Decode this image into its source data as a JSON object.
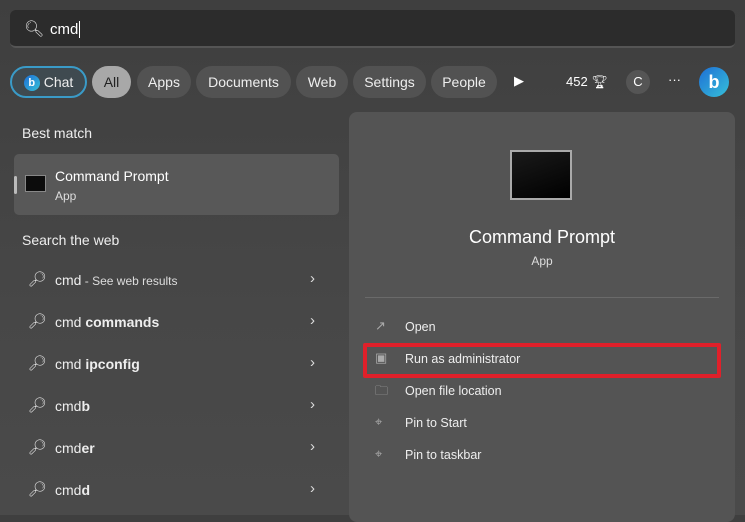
{
  "search": {
    "value": "cmd",
    "icon": "search-icon"
  },
  "filters": {
    "chat": "Chat",
    "items": [
      "All",
      "Apps",
      "Documents",
      "Web",
      "Settings",
      "People"
    ],
    "selected": "All",
    "points": "452",
    "avatar_initial": "C",
    "more": "···"
  },
  "left": {
    "best_match_heading": "Best match",
    "best": {
      "title": "Command Prompt",
      "subtitle": "App"
    },
    "web_heading": "Search the web",
    "web_results": [
      {
        "q": "cmd",
        "rest": "",
        "suffix": " - See web results"
      },
      {
        "q": "cmd",
        "rest": " commands",
        "suffix": ""
      },
      {
        "q": "cmd",
        "rest": " ipconfig",
        "suffix": ""
      },
      {
        "q": "cmd",
        "rest": "b",
        "suffix": ""
      },
      {
        "q": "cmd",
        "rest": "er",
        "suffix": ""
      },
      {
        "q": "cmd",
        "rest": "d",
        "suffix": ""
      }
    ]
  },
  "detail": {
    "title": "Command Prompt",
    "subtitle": "App",
    "actions": [
      {
        "label": "Open",
        "icon": "open-icon"
      },
      {
        "label": "Run as administrator",
        "icon": "admin-shield-icon"
      },
      {
        "label": "Open file location",
        "icon": "folder-icon"
      },
      {
        "label": "Pin to Start",
        "icon": "pin-icon"
      },
      {
        "label": "Pin to taskbar",
        "icon": "pin-icon"
      }
    ],
    "highlight_color": "#e0202a"
  }
}
